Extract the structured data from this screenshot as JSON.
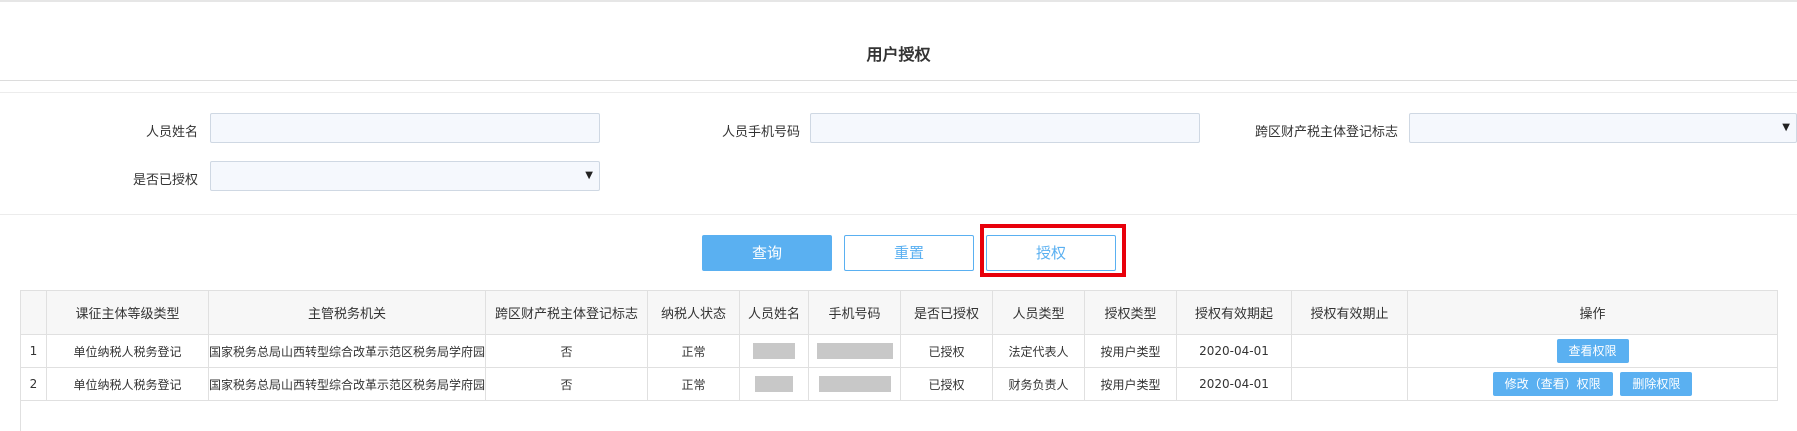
{
  "page": {
    "title": "用户授权"
  },
  "form": {
    "name_label": "人员姓名",
    "name_value": "",
    "phone_label": "人员手机号码",
    "phone_value": "",
    "cross_region_label": "跨区财产税主体登记标志",
    "cross_region_value": "",
    "authorized_label": "是否已授权",
    "authorized_value": ""
  },
  "buttons": {
    "query": "查询",
    "reset": "重置",
    "authorize": "授权"
  },
  "table": {
    "columns": [
      "",
      "课征主体等级类型",
      "主管税务机关",
      "跨区财产税主体登记标志",
      "纳税人状态",
      "人员姓名",
      "手机号码",
      "是否已授权",
      "人员类型",
      "授权类型",
      "授权有效期起",
      "授权有效期止",
      "操作"
    ],
    "rows": [
      {
        "index": "1",
        "levy_type": "单位纳税人税务登记",
        "tax_authority": "国家税务总局山西转型综合改革示范区税务局学府园",
        "cross_region": "否",
        "status": "正常",
        "authorized": "已授权",
        "person_type": "法定代表人",
        "auth_type": "按用户类型",
        "valid_from": "2020-04-01",
        "valid_to": "",
        "actions": [
          "查看权限"
        ]
      },
      {
        "index": "2",
        "levy_type": "单位纳税人税务登记",
        "tax_authority": "国家税务总局山西转型综合改革示范区税务局学府园",
        "cross_region": "否",
        "status": "正常",
        "authorized": "已授权",
        "person_type": "财务负责人",
        "auth_type": "按用户类型",
        "valid_from": "2020-04-01",
        "valid_to": "",
        "actions": [
          "修改（查看）权限",
          "删除权限"
        ]
      }
    ]
  },
  "colors": {
    "accent": "#5ab0f1",
    "highlight": "#e8000b"
  },
  "icons": {
    "dropdown": "caret-down-icon"
  }
}
